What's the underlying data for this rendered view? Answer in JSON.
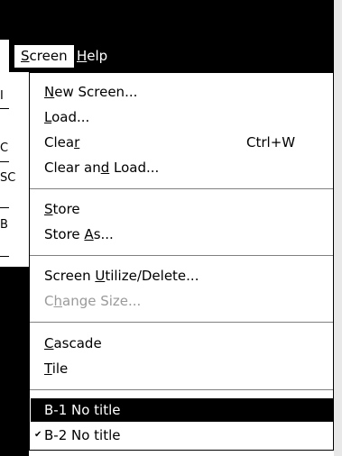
{
  "menubar": {
    "items": [
      {
        "label": "Screen",
        "mnemonic": "S",
        "rest": "creen"
      },
      {
        "label": "Help",
        "mnemonic": "H",
        "rest": "elp"
      }
    ]
  },
  "menu": {
    "new_screen": {
      "pre": "",
      "mnemonic": "N",
      "post": "ew Screen..."
    },
    "load": {
      "pre": "",
      "mnemonic": "L",
      "post": "oad..."
    },
    "clear": {
      "pre": "Clea",
      "mnemonic": "r",
      "post": "",
      "shortcut": "Ctrl+W"
    },
    "clear_and_load": {
      "pre": "Clear an",
      "mnemonic": "d",
      "post": " Load..."
    },
    "store": {
      "pre": "",
      "mnemonic": "S",
      "post": "tore"
    },
    "store_as": {
      "pre": "Store ",
      "mnemonic": "A",
      "post": "s..."
    },
    "screen_utilize": {
      "pre": "Screen ",
      "mnemonic": "U",
      "post": "tilize/Delete..."
    },
    "change_size": {
      "pre": "C",
      "mnemonic": "h",
      "post": "ange Size..."
    },
    "cascade": {
      "pre": "",
      "mnemonic": "C",
      "post": "ascade"
    },
    "tile": {
      "pre": "",
      "mnemonic": "T",
      "post": "ile"
    }
  },
  "windows": [
    {
      "label": "B-1 No title",
      "checked": false,
      "selected": true
    },
    {
      "label": "B-2 No title",
      "checked": true,
      "selected": false
    }
  ],
  "check_mark": "✔",
  "background_fragments": [
    "I",
    "C",
    "SC",
    "B"
  ]
}
